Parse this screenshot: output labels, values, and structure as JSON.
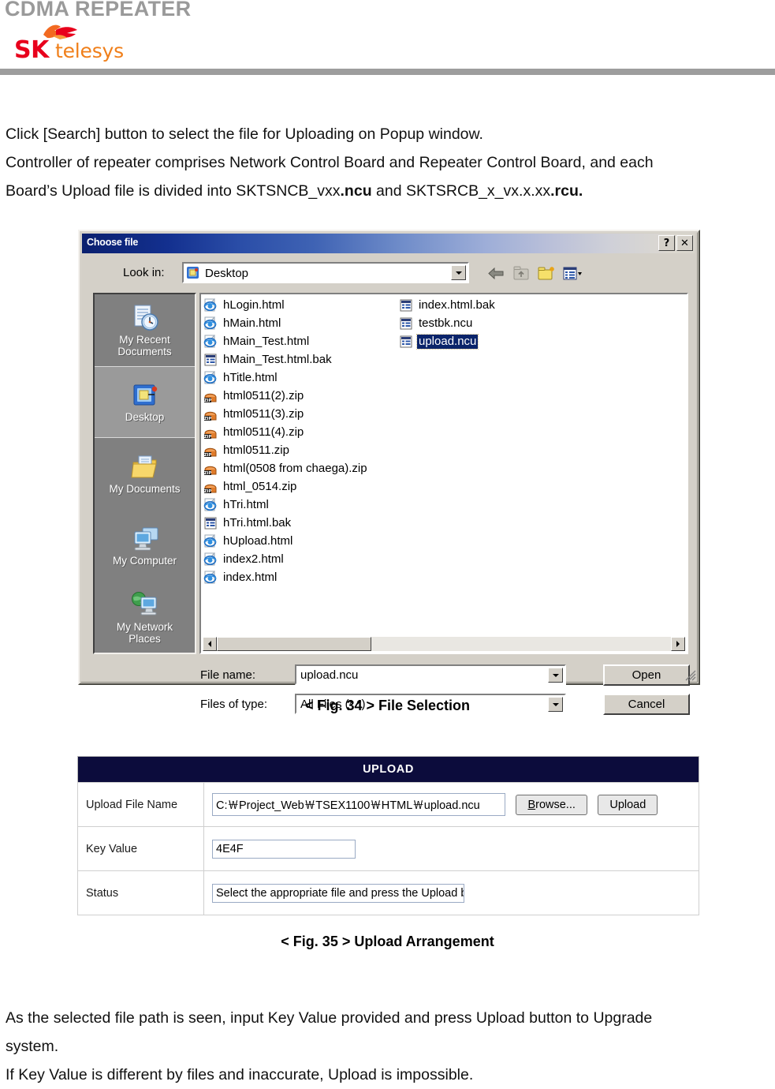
{
  "header": {
    "title": "CDMA REPEATER",
    "logo_primary": "SK",
    "logo_secondary": "telesys"
  },
  "intro_paragraph": {
    "line1": "Click [Search] button to select the file for Uploading on Popup window.",
    "line2": "Controller of repeater comprises Network Control Board and Repeater Control Board, and each",
    "line3_a": "Board’s Upload file is divided into SKTSNCB_vxx",
    "line3_b": ".ncu",
    "line3_c": " and SKTSRCB_x_vx.x.xx",
    "line3_d": ".rcu."
  },
  "file_dialog": {
    "title": "Choose file",
    "help_button": "?",
    "close_button": "✕",
    "look_in_label": "Look in:",
    "look_in_value": "Desktop",
    "toolbar": [
      {
        "name": "back-icon",
        "label": "Back"
      },
      {
        "name": "up-folder-icon",
        "label": "Up One Level"
      },
      {
        "name": "new-folder-icon",
        "label": "Create New Folder"
      },
      {
        "name": "views-icon",
        "label": "Views"
      }
    ],
    "places": [
      {
        "label": "My Recent\nDocuments",
        "icon": "recent-documents-icon",
        "selected": false
      },
      {
        "label": "Desktop",
        "icon": "desktop-icon",
        "selected": true
      },
      {
        "label": "My Documents",
        "icon": "my-documents-icon",
        "selected": false
      },
      {
        "label": "My Computer",
        "icon": "my-computer-icon",
        "selected": false
      },
      {
        "label": "My Network\nPlaces",
        "icon": "my-network-places-icon",
        "selected": false
      }
    ],
    "files_column_1": [
      {
        "name": "hLogin.html",
        "icon": "ie-html-icon",
        "selected": false
      },
      {
        "name": "hMain.html",
        "icon": "ie-html-icon",
        "selected": false
      },
      {
        "name": "hMain_Test.html",
        "icon": "ie-html-icon",
        "selected": false
      },
      {
        "name": "hMain_Test.html.bak",
        "icon": "generic-bak-icon",
        "selected": false
      },
      {
        "name": "hTitle.html",
        "icon": "ie-html-icon",
        "selected": false
      },
      {
        "name": "html0511(2).zip",
        "icon": "zip-icon",
        "selected": false
      },
      {
        "name": "html0511(3).zip",
        "icon": "zip-icon",
        "selected": false
      },
      {
        "name": "html0511(4).zip",
        "icon": "zip-icon",
        "selected": false
      },
      {
        "name": "html0511.zip",
        "icon": "zip-icon",
        "selected": false
      },
      {
        "name": "html(0508 from chaega).zip",
        "icon": "zip-icon",
        "selected": false
      },
      {
        "name": "html_0514.zip",
        "icon": "zip-icon",
        "selected": false
      },
      {
        "name": "hTri.html",
        "icon": "ie-html-icon",
        "selected": false
      },
      {
        "name": "hTri.html.bak",
        "icon": "generic-bak-icon",
        "selected": false
      },
      {
        "name": "hUpload.html",
        "icon": "ie-html-icon",
        "selected": false
      },
      {
        "name": "index2.html",
        "icon": "ie-html-icon",
        "selected": false
      },
      {
        "name": "index.html",
        "icon": "ie-html-icon",
        "selected": false
      }
    ],
    "files_column_2": [
      {
        "name": "index.html.bak",
        "icon": "generic-bak-icon",
        "selected": false
      },
      {
        "name": "testbk.ncu",
        "icon": "generic-bak-icon",
        "selected": false
      },
      {
        "name": "upload.ncu",
        "icon": "generic-bak-icon",
        "selected": true
      }
    ],
    "file_name_label": "File name:",
    "file_name_value": "upload.ncu",
    "files_of_type_label": "Files of type:",
    "files_of_type_value": "All Files (*.*)",
    "open_button": "Open",
    "cancel_button": "Cancel"
  },
  "caption_34": "< Fig. 34 > File Selection",
  "caption_35": "< Fig. 35 > Upload Arrangement",
  "upload_table": {
    "header": "UPLOAD",
    "rows": [
      {
        "label": "Upload File Name",
        "value": "C:￦Project_Web￦TSEX1100￦HTML￦upload.ncu"
      },
      {
        "label": "Key Value",
        "value": "4E4F"
      },
      {
        "label": "Status",
        "value": "Select the appropriate file and press the Upload button"
      }
    ],
    "browse_button": "Browse...",
    "browse_button_accel": "B",
    "upload_button": "Upload"
  },
  "closing_paragraph": {
    "line1": "As the selected file path is seen, input Key Value provided and press Upload button to Upgrade",
    "line2": "system.",
    "line3": "If Key Value is different by files and inaccurate, Upload is impossible."
  },
  "colors": {
    "header_title": "#9a9a9a",
    "header_rule": "#9d9d9d",
    "logo_red": "#e8001c",
    "logo_orange": "#f07f1a",
    "table_header_bg": "#0c0c3c",
    "dialog_face": "#d4d0c8",
    "selection_blue": "#0a246a"
  }
}
